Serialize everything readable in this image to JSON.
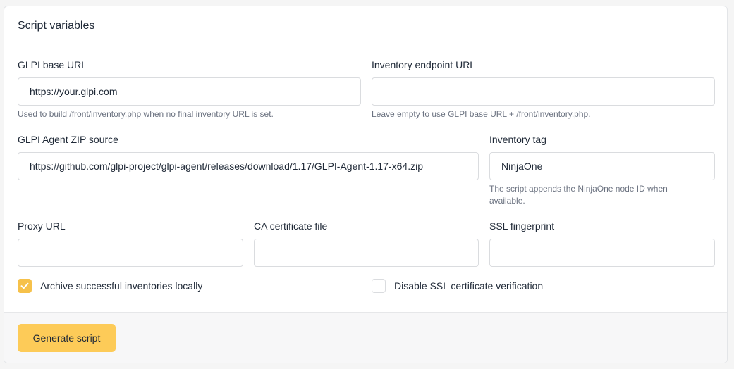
{
  "card": {
    "title": "Script variables"
  },
  "fields": {
    "glpi_base_url": {
      "label": "GLPI base URL",
      "value": "https://your.glpi.com",
      "help": "Used to build /front/inventory.php when no final inventory URL is set."
    },
    "inventory_endpoint_url": {
      "label": "Inventory endpoint URL",
      "value": "",
      "help": "Leave empty to use GLPI base URL + /front/inventory.php."
    },
    "agent_zip_source": {
      "label": "GLPI Agent ZIP source",
      "value": "https://github.com/glpi-project/glpi-agent/releases/download/1.17/GLPI-Agent-1.17-x64.zip"
    },
    "inventory_tag": {
      "label": "Inventory tag",
      "value": "NinjaOne",
      "help": "The script appends the NinjaOne node ID when available."
    },
    "proxy_url": {
      "label": "Proxy URL",
      "value": ""
    },
    "ca_certificate_file": {
      "label": "CA certificate file",
      "value": ""
    },
    "ssl_fingerprint": {
      "label": "SSL fingerprint",
      "value": ""
    }
  },
  "options": {
    "archive_inventories": {
      "label": "Archive successful inventories locally",
      "checked": true
    },
    "disable_ssl_verification": {
      "label": "Disable SSL certificate verification",
      "checked": false
    }
  },
  "footer": {
    "generate_label": "Generate script"
  },
  "colors": {
    "accent": "#fdcb58",
    "checkbox_checked": "#f6c14a"
  },
  "icons": {
    "checkmark": "check-icon"
  }
}
